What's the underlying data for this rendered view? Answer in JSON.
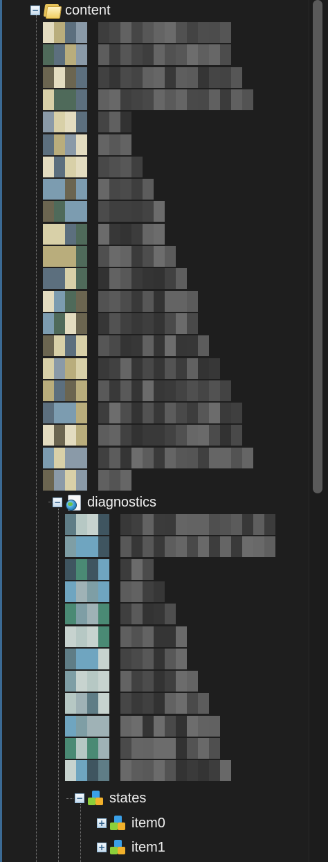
{
  "tree": {
    "content": {
      "label": "content",
      "icon": "folder-icon",
      "expanded": true,
      "toggle": "−"
    },
    "diagnostics": {
      "label": "diagnostics",
      "icon": "diagnostics-icon",
      "expanded": true,
      "toggle": "−"
    },
    "states": {
      "label": "states",
      "icon": "blocks-icon",
      "expanded": true,
      "toggle": "−"
    },
    "items": [
      {
        "label": "item0",
        "icon": "blocks-icon",
        "expanded": false,
        "toggle": "+"
      },
      {
        "label": "item1",
        "icon": "blocks-icon",
        "expanded": false,
        "toggle": "+"
      }
    ]
  },
  "colors": {
    "background": "#1e1e1e",
    "guide": "#7a7a7a",
    "scrollbar_thumb": "#5a5a5a",
    "selection_edge": "#3b6a94"
  },
  "redacted_children": {
    "content_count": 21,
    "diagnostics_count": 12
  }
}
